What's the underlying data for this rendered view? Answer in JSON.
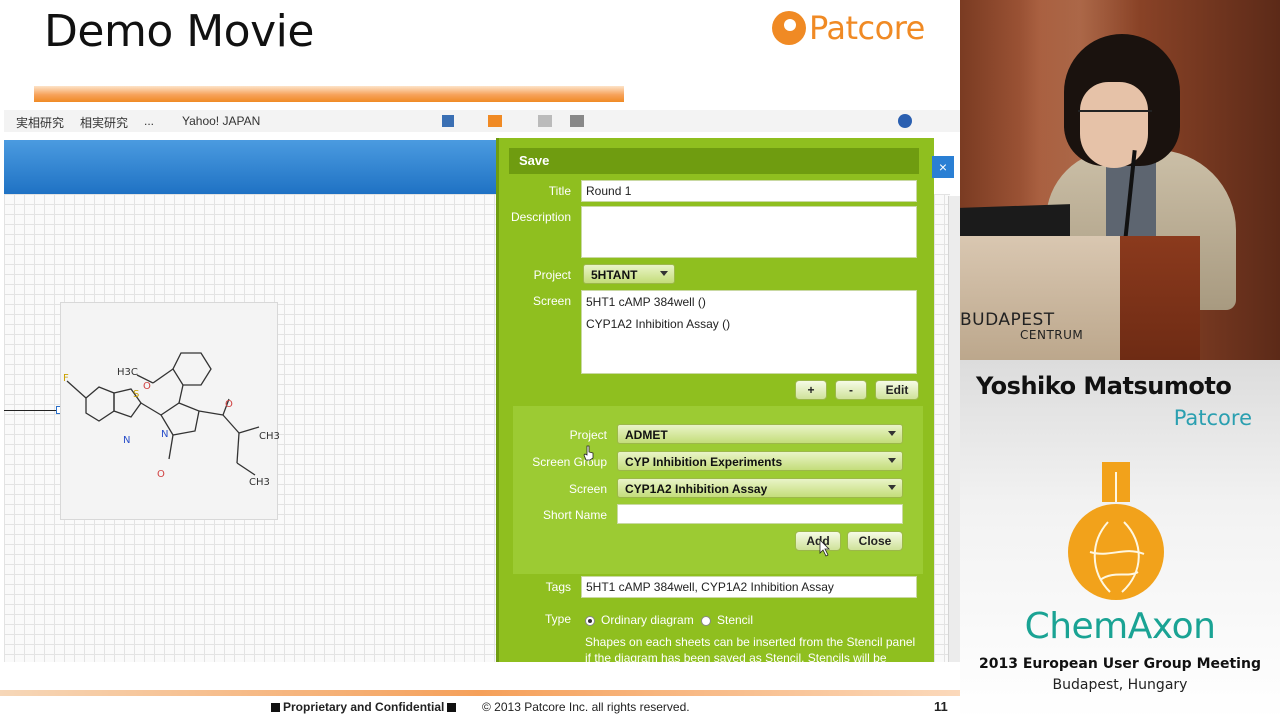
{
  "slide": {
    "title": "Demo Movie",
    "brand": "Patcore",
    "footer": {
      "confidential": "Proprietary and Confidential",
      "copyright": "© 2013 Patcore Inc. all rights reserved.",
      "page_number": "11"
    }
  },
  "browser_bar": {
    "items": [
      "実相研究",
      "相実研究",
      "...",
      "Yahoo! JAPAN"
    ]
  },
  "molecule": {
    "atoms": [
      "F",
      "H3C",
      "O",
      "S",
      "N",
      "N",
      "O",
      "O",
      "CH3",
      "CH3"
    ]
  },
  "save_dialog": {
    "header": "Save",
    "title_label": "Title",
    "title_value": "Round 1",
    "description_label": "Description",
    "description_value": "",
    "project_label": "Project",
    "project_value": "5HTANT",
    "screen_label": "Screen",
    "screen_list": [
      "5HT1 cAMP 384well ()",
      "CYP1A2 Inhibition Assay ()"
    ],
    "plus_button": "+",
    "minus_button": "-",
    "edit_button": "Edit",
    "sub_panel": {
      "project_label": "Project",
      "project_value": "ADMET",
      "screen_group_label": "Screen Group",
      "screen_group_value": "CYP Inhibition Experiments",
      "screen_label": "Screen",
      "screen_value": "CYP1A2 Inhibition Assay",
      "short_name_label": "Short Name",
      "short_name_value": "",
      "add_button": "Add",
      "close_button": "Close"
    },
    "tags_label": "Tags",
    "tags_value": "5HT1 cAMP 384well, CYP1A2 Inhibition Assay",
    "type_label": "Type",
    "type_options": [
      "Ordinary diagram",
      "Stencil"
    ],
    "type_selected": "Ordinary diagram",
    "type_help": "Shapes on each sheets can be inserted from the Stencil panel if the diagram has been saved as Stencil. Stencils will be",
    "close_x": "×"
  },
  "video": {
    "podium_line1": "BUDAPEST",
    "podium_line2": "CENTRUM"
  },
  "caption": {
    "speaker_name": "Yoshiko Matsumoto",
    "speaker_org": "Patcore",
    "sponsor": "ChemAxon",
    "event": "2013 European User Group Meeting",
    "location": "Budapest, Hungary"
  },
  "colors": {
    "accent_orange": "#f08a24",
    "dialog_green": "#8fbf1f",
    "header_blue": "#1f72c4",
    "chemaxon_teal": "#1aa394",
    "patcore_teal": "#2a9fb0"
  }
}
